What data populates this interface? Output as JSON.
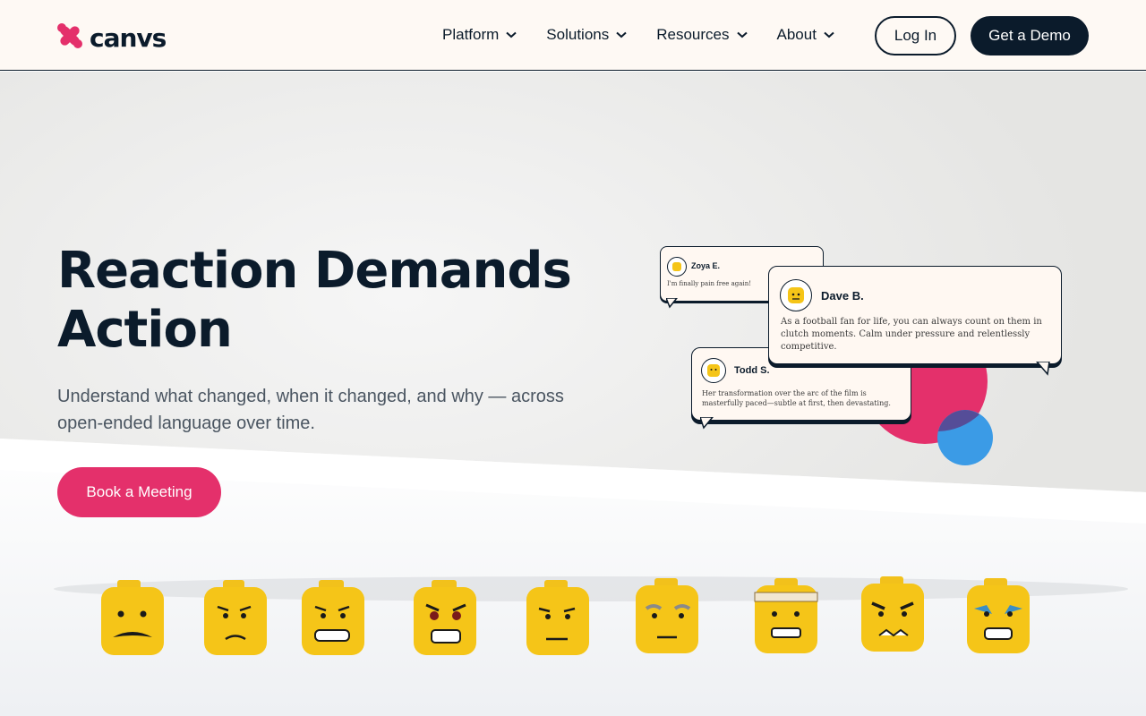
{
  "brand": {
    "name": "canvs",
    "accent": "#e4306b",
    "dark": "#0b1b2b"
  },
  "nav": {
    "items": [
      {
        "label": "Platform",
        "icon": "chevron-down-icon"
      },
      {
        "label": "Solutions",
        "icon": "chevron-down-icon"
      },
      {
        "label": "Resources",
        "icon": "chevron-down-icon"
      },
      {
        "label": "About",
        "icon": "chevron-down-icon"
      }
    ],
    "login": "Log In",
    "demo": "Get a Demo"
  },
  "hero": {
    "title": "Reaction Demands Action",
    "subtitle": "Understand what changed, when it changed, and why — across open-ended language over time.",
    "cta": "Book a Meeting"
  },
  "reviews": [
    {
      "name": "Zoya E.",
      "text": "I'm finally pain free again!"
    },
    {
      "name": "Dave B.",
      "text": "As a football fan for life, you can always count on them in clutch moments. Calm under pressure and relentlessly competitive."
    },
    {
      "name": "Todd S.",
      "text": "Her transformation over the arc of the film is masterfully paced—subtle at first, then devastating."
    }
  ],
  "decor": {
    "circle_pink": "#e4306b",
    "circle_blue": "#3b9be6"
  }
}
